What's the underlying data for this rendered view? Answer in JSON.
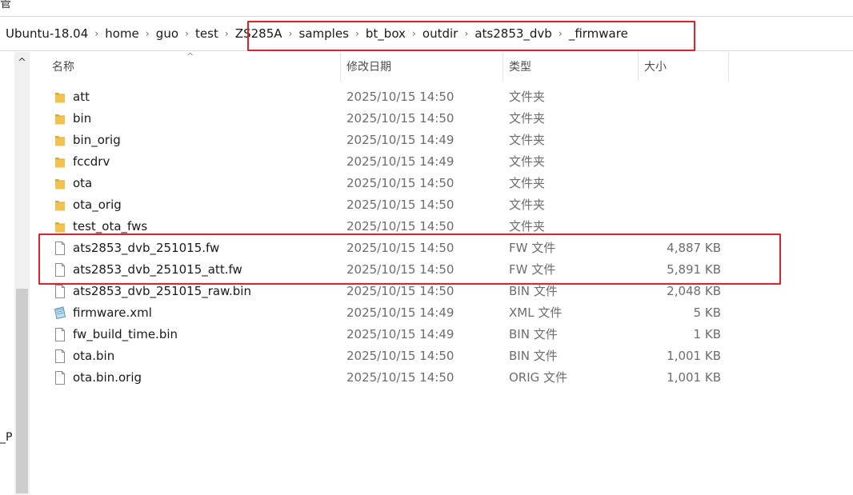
{
  "top": {
    "glyph": "管"
  },
  "breadcrumb": [
    "Ubuntu-18.04",
    "home",
    "guo",
    "test",
    "ZS285A",
    "samples",
    "bt_box",
    "outdir",
    "ats2853_dvb",
    "_firmware"
  ],
  "nav": {
    "partial_label": "_P"
  },
  "columns": {
    "name": "名称",
    "date": "修改日期",
    "type": "类型",
    "size": "大小"
  },
  "files": [
    {
      "name": "att",
      "date": "2025/10/15 14:50",
      "type": "文件夹",
      "size": "",
      "icon": "folder-icon"
    },
    {
      "name": "bin",
      "date": "2025/10/15 14:50",
      "type": "文件夹",
      "size": "",
      "icon": "folder-icon"
    },
    {
      "name": "bin_orig",
      "date": "2025/10/15 14:49",
      "type": "文件夹",
      "size": "",
      "icon": "folder-icon"
    },
    {
      "name": "fccdrv",
      "date": "2025/10/15 14:49",
      "type": "文件夹",
      "size": "",
      "icon": "folder-icon"
    },
    {
      "name": "ota",
      "date": "2025/10/15 14:50",
      "type": "文件夹",
      "size": "",
      "icon": "folder-icon"
    },
    {
      "name": "ota_orig",
      "date": "2025/10/15 14:50",
      "type": "文件夹",
      "size": "",
      "icon": "folder-icon"
    },
    {
      "name": "test_ota_fws",
      "date": "2025/10/15 14:50",
      "type": "文件夹",
      "size": "",
      "icon": "folder-icon"
    },
    {
      "name": "ats2853_dvb_251015.fw",
      "date": "2025/10/15 14:50",
      "type": "FW 文件",
      "size": "4,887 KB",
      "icon": "file-icon"
    },
    {
      "name": "ats2853_dvb_251015_att.fw",
      "date": "2025/10/15 14:50",
      "type": "FW 文件",
      "size": "5,891 KB",
      "icon": "file-icon"
    },
    {
      "name": "ats2853_dvb_251015_raw.bin",
      "date": "2025/10/15 14:50",
      "type": "BIN 文件",
      "size": "2,048 KB",
      "icon": "file-icon"
    },
    {
      "name": "firmware.xml",
      "date": "2025/10/15 14:49",
      "type": "XML 文件",
      "size": "5 KB",
      "icon": "xml-file-icon"
    },
    {
      "name": "fw_build_time.bin",
      "date": "2025/10/15 14:49",
      "type": "BIN 文件",
      "size": "1 KB",
      "icon": "file-icon"
    },
    {
      "name": "ota.bin",
      "date": "2025/10/15 14:50",
      "type": "BIN 文件",
      "size": "1,001 KB",
      "icon": "file-icon"
    },
    {
      "name": "ota.bin.orig",
      "date": "2025/10/15 14:50",
      "type": "ORIG 文件",
      "size": "1,001 KB",
      "icon": "file-icon"
    }
  ],
  "colors": {
    "highlight": "#e0202a",
    "folder": "#f2c14e",
    "text_secondary": "#6d6d6d"
  }
}
